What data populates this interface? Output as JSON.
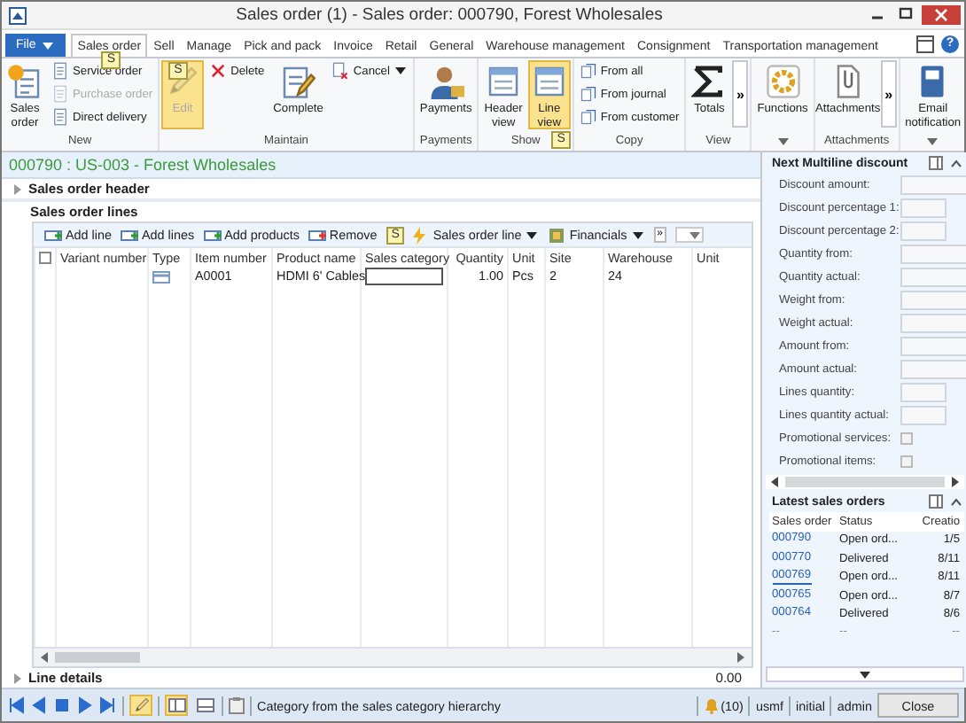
{
  "window": {
    "title": "Sales order (1) - Sales order: 000790, Forest Wholesales"
  },
  "file_button": "File",
  "tabs": [
    {
      "label": "Sales order",
      "selected": true,
      "keytip": "S"
    },
    {
      "label": "Sell",
      "selected": false
    },
    {
      "label": "Manage",
      "selected": false
    },
    {
      "label": "Pick and pack",
      "selected": false
    },
    {
      "label": "Invoice",
      "selected": false
    },
    {
      "label": "Retail",
      "selected": false
    },
    {
      "label": "General",
      "selected": false
    },
    {
      "label": "Warehouse management",
      "selected": false
    },
    {
      "label": "Consignment",
      "selected": false
    },
    {
      "label": "Transportation management",
      "selected": false
    }
  ],
  "help": "?",
  "ribbon": {
    "groups": [
      {
        "label": "New",
        "launcher": false,
        "buttons": [
          {
            "label": "Sales order",
            "kind": "large",
            "disabled": false,
            "highlighted": false
          },
          {
            "label": "Service order",
            "kind": "small",
            "disabled": false,
            "highlighted": false
          },
          {
            "label": "Purchase order",
            "kind": "small",
            "disabled": true,
            "highlighted": false
          },
          {
            "label": "Direct delivery",
            "kind": "small",
            "disabled": false,
            "highlighted": false
          }
        ]
      },
      {
        "label": "Maintain",
        "launcher": false,
        "buttons": [
          {
            "label": "Edit",
            "kind": "large",
            "disabled": true,
            "highlighted": true,
            "keytip": "S"
          },
          {
            "label": "Delete",
            "kind": "small",
            "disabled": false,
            "highlighted": false
          },
          {
            "label": "Complete",
            "kind": "large",
            "disabled": false,
            "highlighted": false
          },
          {
            "label": "Cancel",
            "kind": "menu",
            "disabled": false,
            "highlighted": false
          }
        ]
      },
      {
        "label": "Payments",
        "launcher": false,
        "buttons": [
          {
            "label": "Payments",
            "kind": "large",
            "disabled": false,
            "highlighted": false
          }
        ]
      },
      {
        "label": "Show",
        "launcher": false,
        "keytip": "S",
        "buttons": [
          {
            "label": "Header view",
            "kind": "large",
            "disabled": false,
            "highlighted": false
          },
          {
            "label": "Line view",
            "kind": "large",
            "disabled": false,
            "highlighted": true
          }
        ]
      },
      {
        "label": "Copy",
        "launcher": false,
        "buttons": [
          {
            "label": "From all",
            "kind": "small",
            "disabled": false,
            "highlighted": false
          },
          {
            "label": "From journal",
            "kind": "small",
            "disabled": false,
            "highlighted": false
          },
          {
            "label": "From customer",
            "kind": "small",
            "disabled": false,
            "highlighted": false
          }
        ]
      },
      {
        "label": "View",
        "launcher": false,
        "buttons": [
          {
            "label": "Totals",
            "kind": "large",
            "disabled": false,
            "highlighted": false
          },
          {
            "label": "»",
            "kind": "overflow"
          }
        ]
      },
      {
        "launcher": true,
        "buttons": [
          {
            "label": "Functions",
            "kind": "large",
            "disabled": false,
            "highlighted": false
          }
        ]
      },
      {
        "label": "Attachments",
        "launcher": false,
        "buttons": [
          {
            "label": "Attachments",
            "kind": "large",
            "disabled": false,
            "highlighted": false
          },
          {
            "label": "»",
            "kind": "overflow"
          }
        ]
      },
      {
        "launcher": true,
        "buttons": [
          {
            "label": "Email notification",
            "kind": "large",
            "disabled": false,
            "highlighted": false
          }
        ]
      }
    ]
  },
  "record_header": "000790 : US-003 - Forest Wholesales",
  "header_section": {
    "title": "Sales order header",
    "expanded": false
  },
  "lines_section": {
    "title": "Sales order lines",
    "toolbar": [
      {
        "label": "Add line",
        "kind": "button"
      },
      {
        "label": "Add lines",
        "kind": "button"
      },
      {
        "label": "Add products",
        "kind": "button"
      },
      {
        "label": "Remove",
        "kind": "button"
      },
      {
        "label": "Sales order line",
        "kind": "menu",
        "keytip": "S"
      },
      {
        "label": "Financials",
        "kind": "menu"
      },
      {
        "label": "»",
        "kind": "overflow"
      },
      {
        "kind": "combo"
      }
    ],
    "select_all_checked": false,
    "columns": [
      "Variant number",
      "Type",
      "Item number",
      "Product name",
      "Sales category",
      "Quantity",
      "Unit",
      "Site",
      "Warehouse",
      "Unit"
    ],
    "rows": [
      {
        "cells": [
          {
            "kind": "empty"
          },
          {
            "kind": "icon"
          },
          {
            "kind": "text",
            "text": "A0001"
          },
          {
            "kind": "text",
            "text": "HDMI 6' Cables"
          },
          {
            "kind": "input"
          },
          {
            "kind": "number",
            "text": "1.00"
          },
          {
            "kind": "text",
            "text": "Pcs"
          },
          {
            "kind": "text",
            "text": "2"
          },
          {
            "kind": "text",
            "text": "24"
          },
          {
            "kind": "empty"
          }
        ]
      }
    ]
  },
  "details_section": {
    "title": "Line details",
    "expanded": false,
    "summary": "0.00"
  },
  "factboxes": [
    {
      "title": "Next Multiline discount",
      "expanded": true,
      "fields": [
        {
          "label": "Discount amount:",
          "kind": "field"
        },
        {
          "label": "Discount percentage 1:",
          "kind": "short-field"
        },
        {
          "label": "Discount percentage 2:",
          "kind": "short-field"
        },
        {
          "label": "Quantity from:",
          "kind": "field"
        },
        {
          "label": "Quantity actual:",
          "kind": "field"
        },
        {
          "label": "Weight from:",
          "kind": "field"
        },
        {
          "label": "Weight actual:",
          "kind": "field"
        },
        {
          "label": "Amount from:",
          "kind": "field"
        },
        {
          "label": "Amount actual:",
          "kind": "field"
        },
        {
          "label": "Lines quantity:",
          "kind": "short-field"
        },
        {
          "label": "Lines quantity actual:",
          "kind": "short-field"
        },
        {
          "label": "Promotional services:",
          "kind": "checkbox",
          "checked": false
        },
        {
          "label": "Promotional items:",
          "kind": "checkbox",
          "checked": false
        }
      ]
    },
    {
      "title": "Latest sales orders",
      "expanded": true,
      "columns": [
        "Sales order",
        "Status",
        "Creatio"
      ],
      "rows": [
        {
          "kind": "record",
          "hovered": false,
          "cells": [
            "000790",
            "Open ord...",
            "1/5"
          ]
        },
        {
          "kind": "record",
          "hovered": false,
          "cells": [
            "000770",
            "Delivered",
            "8/11"
          ]
        },
        {
          "kind": "record",
          "hovered": true,
          "cells": [
            "000769",
            "Open ord...",
            "8/11"
          ]
        },
        {
          "kind": "record",
          "hovered": false,
          "cells": [
            "000765",
            "Open ord...",
            "8/7"
          ]
        },
        {
          "kind": "record",
          "hovered": false,
          "cells": [
            "000764",
            "Delivered",
            "8/6"
          ]
        },
        {
          "kind": "placeholder",
          "hovered": false,
          "cells": [
            "--",
            "--",
            "--"
          ]
        }
      ]
    }
  ],
  "status_bar": {
    "edit_mode": true,
    "views": [
      {
        "selected": true
      },
      {
        "selected": false
      }
    ],
    "message": "Category from the sales category hierarchy",
    "notifications": "(10)",
    "company": "usmf",
    "partition": "initial",
    "user": "admin",
    "close": "Close"
  }
}
